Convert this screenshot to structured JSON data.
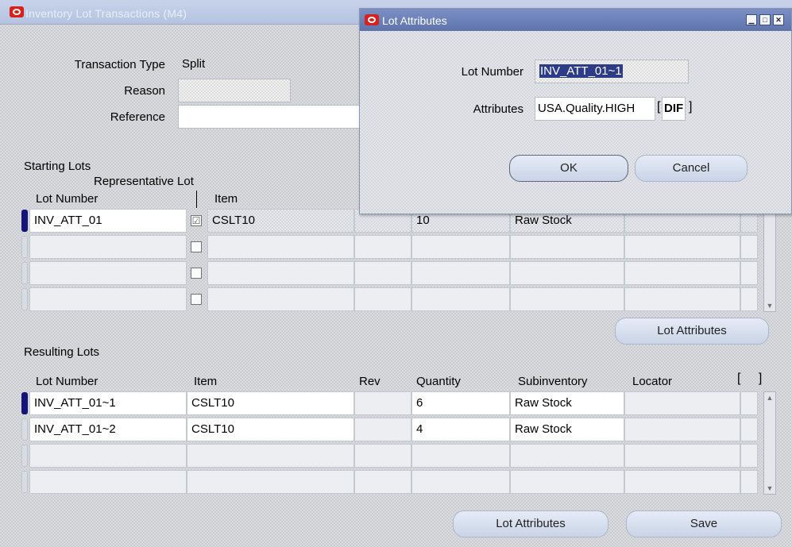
{
  "window": {
    "title": "Inventory Lot Transactions (M4)"
  },
  "header": {
    "transaction_type_label": "Transaction Type",
    "transaction_type_value": "Split",
    "reason_label": "Reason",
    "reason_value": "",
    "reference_label": "Reference",
    "reference_value": ""
  },
  "starting_lots": {
    "title": "Starting Lots",
    "columns": {
      "lot_number": "Lot Number",
      "representative_lot": "Representative Lot",
      "item": "Item"
    },
    "rows": [
      {
        "lot_number": "INV_ATT_01",
        "representative": true,
        "item": "CSLT10",
        "quantity": "10",
        "subinventory": "Raw Stock"
      },
      {
        "lot_number": "",
        "representative": false,
        "item": "",
        "quantity": "",
        "subinventory": ""
      },
      {
        "lot_number": "",
        "representative": false,
        "item": "",
        "quantity": "",
        "subinventory": ""
      },
      {
        "lot_number": "",
        "representative": false,
        "item": "",
        "quantity": "",
        "subinventory": ""
      }
    ],
    "lot_attributes_button": "Lot Attributes"
  },
  "resulting_lots": {
    "title": "Resulting Lots",
    "columns": {
      "lot_number": "Lot Number",
      "item": "Item",
      "rev": "Rev",
      "quantity": "Quantity",
      "subinventory": "Subinventory",
      "locator": "Locator",
      "flex": "[ ]"
    },
    "rows": [
      {
        "lot_number": "INV_ATT_01~1",
        "item": "CSLT10",
        "rev": "",
        "quantity": "6",
        "subinventory": "Raw Stock",
        "locator": ""
      },
      {
        "lot_number": "INV_ATT_01~2",
        "item": "CSLT10",
        "rev": "",
        "quantity": "4",
        "subinventory": "Raw Stock",
        "locator": ""
      },
      {
        "lot_number": "",
        "item": "",
        "rev": "",
        "quantity": "",
        "subinventory": "",
        "locator": ""
      },
      {
        "lot_number": "",
        "item": "",
        "rev": "",
        "quantity": "",
        "subinventory": "",
        "locator": ""
      }
    ]
  },
  "footer": {
    "lot_attributes_button": "Lot Attributes",
    "save_button": "Save"
  },
  "dialog": {
    "title": "Lot Attributes",
    "lot_number_label": "Lot Number",
    "lot_number_value": "INV_ATT_01~1",
    "attributes_label": "Attributes",
    "attributes_value": "USA.Quality.HIGH",
    "dff_value": "DIF",
    "ok_button": "OK",
    "cancel_button": "Cancel"
  },
  "colors": {
    "title_bar": "#b5c3e1",
    "dialog_title_bar": "#5f74ad",
    "current_record": "#13137a",
    "oracle_icon": "#d8201c"
  },
  "icons": [
    "oracle-icon",
    "minimize-icon",
    "maximize-icon",
    "close-icon",
    "scroll-up-icon",
    "scroll-down-icon",
    "checkbox-icon"
  ]
}
